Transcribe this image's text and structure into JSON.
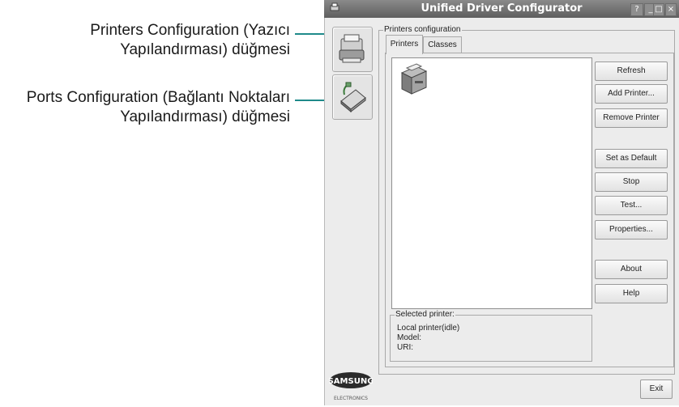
{
  "callouts": {
    "printers_line1": "Printers Configuration (Yazıcı",
    "printers_line2": "Yapılandırması) düğmesi",
    "ports_line1": "Ports Configuration (Bağlantı Noktaları",
    "ports_line2": "Yapılandırması) düğmesi",
    "accent_color": "#1f8a8a"
  },
  "window": {
    "title": "Unified Driver Configurator",
    "help_btn": "?",
    "minimize_btn": "_",
    "maximize_btn": "□",
    "close_btn": "×"
  },
  "sidebar": {
    "printers_icon": "printer-icon",
    "ports_icon": "port-cable-icon"
  },
  "panel": {
    "group_label": "Printers configuration",
    "tabs": [
      {
        "label": "Printers"
      },
      {
        "label": "Classes"
      }
    ]
  },
  "printer_list": {
    "items": [
      {
        "icon": "printer-icon"
      }
    ]
  },
  "buttons": {
    "refresh": "Refresh",
    "add": "Add Printer...",
    "remove": "Remove Printer",
    "set_default": "Set as Default",
    "stop": "Stop",
    "test": "Test...",
    "properties": "Properties...",
    "about": "About",
    "help": "Help",
    "exit": "Exit"
  },
  "selected": {
    "label": "Selected printer:",
    "line1": "Local printer(idle)",
    "line2": "Model:",
    "line3": "URI:"
  },
  "logo": {
    "brand": "SAMSUNG",
    "sub": "ELECTRONICS"
  }
}
